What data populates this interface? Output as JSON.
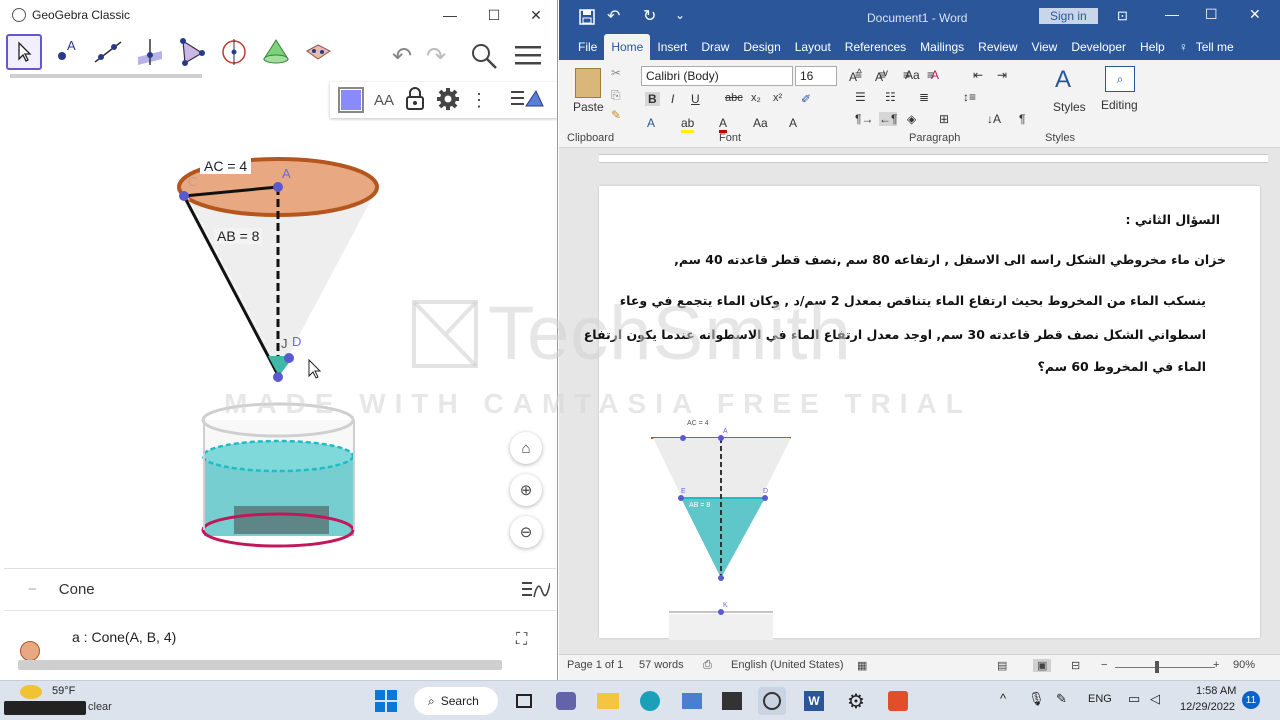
{
  "geogebra": {
    "title": "GeoGebra Classic",
    "controls": {
      "minimize": "—",
      "maximize": "☐",
      "close": "✕"
    },
    "tools": [
      "move-tool",
      "point-tool",
      "line-tool",
      "perpendicular-tool",
      "polygon-tool",
      "circle-tool",
      "pyramid-tool",
      "net-tool"
    ],
    "undo_redo": {
      "undo": "↶",
      "redo": "↷"
    },
    "style_bar": {
      "text_style": "AA"
    },
    "labels": {
      "ac": "AC = 4",
      "ab": "AB = 8",
      "a": "A",
      "c": "C",
      "j": "J",
      "d": "D"
    },
    "algebra": {
      "header": "Cone",
      "entry": "a : Cone(A, B, 4)",
      "collapse": "−"
    },
    "nav": {
      "home": "⌂",
      "zoom_in": "⊕",
      "zoom_out": "⊖",
      "fullscreen": "⛶"
    }
  },
  "word": {
    "title": "Document1 - Word",
    "sign_in": "Sign in",
    "tabs": [
      "File",
      "Home",
      "Insert",
      "Draw",
      "Design",
      "Layout",
      "References",
      "Mailings",
      "Review",
      "View",
      "Developer",
      "Help",
      "Tell me"
    ],
    "active_tab": "Home",
    "ribbon": {
      "paste": "Paste",
      "font_name": "Calibri (Body)",
      "font_size": "16",
      "styles": "Styles",
      "editing": "Editing",
      "groups": {
        "clipboard": "Clipboard",
        "font": "Font",
        "paragraph": "Paragraph",
        "styles": "Styles"
      }
    },
    "document": {
      "lines": [
        "السؤال الثاني :",
        "خزان ماء مخروطي الشكل راسه الى الاسفل , ارتفاعه 80 سم ,نصف قطر قاعدته 40 سم,",
        "ينسكب الماء من المخروط بحيث ارتفاع الماء يتناقص بمعدل 2 سم/د , وكان الماء يتجمع في وعاء",
        "اسطواني الشكل نصف قطر قاعدته 30 سم, اوجد معدل ارتفاع الماء في الاسطوانه عندما يكون ارتفاع",
        "الماء في المخروط 60 سم؟"
      ],
      "figure_labels": {
        "ac": "AC = 4",
        "ab": "AB = 8",
        "a": "A",
        "e": "E",
        "d": "D",
        "k": "K"
      }
    },
    "status": {
      "page": "Page 1 of 1",
      "words": "57 words",
      "language": "English (United States)",
      "zoom": "90%"
    }
  },
  "watermark": {
    "brand": "TechSmith",
    "trial": "MADE WITH CAMTASIA FREE TRIAL"
  },
  "taskbar": {
    "weather_temp": "59°F",
    "weather_desc": "clear",
    "search": "Search",
    "lang": "ENG",
    "time": "1:58 AM",
    "date": "12/29/2022",
    "notifications": "11"
  },
  "colors": {
    "word_blue": "#2b579a",
    "gg_purple": "#6557d2",
    "cone_orange": "#e8a882",
    "water_teal": "#5fc7c9",
    "cyl_rim": "#c2185b"
  }
}
